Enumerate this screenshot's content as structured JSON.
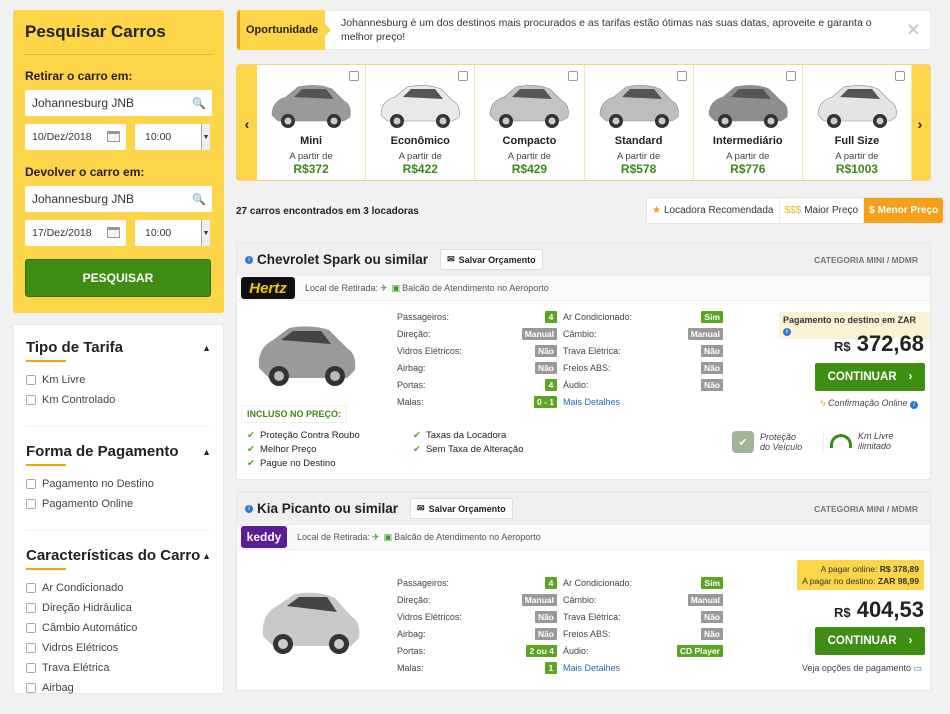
{
  "search": {
    "title": "Pesquisar Carros",
    "pickup_label": "Retirar o carro em:",
    "pickup_location": "Johannesburg JNB",
    "pickup_date": "10/Dez/2018",
    "pickup_time": "10:00",
    "return_label": "Devolver o carro em:",
    "return_location": "Johannesburg JNB",
    "return_date": "17/Dez/2018",
    "return_time": "10:00",
    "button": "PESQUISAR"
  },
  "filters": [
    {
      "title": "Tipo de Tarifa",
      "options": [
        "Km Livre",
        "Km Controlado"
      ]
    },
    {
      "title": "Forma de Pagamento",
      "options": [
        "Pagamento no Destino",
        "Pagamento Online"
      ]
    },
    {
      "title": "Características do Carro",
      "options": [
        "Ar Condicionado",
        "Direção Hidráulica",
        "Câmbio Automático",
        "Vidros Elétricos",
        "Trava Elétrica",
        "Airbag"
      ]
    }
  ],
  "banner": {
    "tag": "Oportunidade",
    "text": "Johannesburg é um dos destinos mais procurados e as tarifas estão ótimas nas suas datas, aproveite e garanta o melhor preço!",
    "close": "✕"
  },
  "categories": [
    {
      "name": "Mini",
      "from": "A partir de",
      "price": "R$372",
      "color": "#9a9a9a"
    },
    {
      "name": "Econômico",
      "from": "A partir de",
      "price": "R$422",
      "color": "#e9e9e9"
    },
    {
      "name": "Compacto",
      "from": "A partir de",
      "price": "R$429",
      "color": "#c4c4c4"
    },
    {
      "name": "Standard",
      "from": "A partir de",
      "price": "R$578",
      "color": "#bdbdbd"
    },
    {
      "name": "Intermediário",
      "from": "A partir de",
      "price": "R$776",
      "color": "#8e8e8e"
    },
    {
      "name": "Full Size",
      "from": "A partir de",
      "price": "R$1003",
      "color": "#e4e4e4"
    }
  ],
  "results": {
    "count": "27 carros encontrados em 3 locadoras",
    "sort": [
      "Locadora Recomendada",
      "Maior Preço",
      "Menor Preço"
    ],
    "sort_prefix": [
      "★",
      "$$$",
      "$"
    ]
  },
  "cars": [
    {
      "title": "Chevrolet Spark ou similar",
      "save": "Salvar Orçamento",
      "category": "CATEGORIA MINI / MDMR",
      "provider": "Hertz",
      "pickup": "Local de Retirada:",
      "pickup_place": "Balcão de Atendimento no Aeroporto",
      "specs_left": [
        [
          "Passageiros:",
          "4",
          "g"
        ],
        [
          "Direção:",
          "Manual",
          "gr"
        ],
        [
          "Vidros Elétricos:",
          "Não",
          "gr"
        ],
        [
          "Airbag:",
          "Não",
          "gr"
        ],
        [
          "Portas:",
          "4",
          "g"
        ],
        [
          "Malas:",
          "0 - 1",
          "g"
        ]
      ],
      "specs_right": [
        [
          "Ar Condicionado:",
          "Sim",
          "g"
        ],
        [
          "Câmbio:",
          "Manual",
          "gr"
        ],
        [
          "Trava Elétrica:",
          "Não",
          "gr"
        ],
        [
          "Freios ABS:",
          "Não",
          "gr"
        ],
        [
          "Áudio:",
          "Não",
          "gr"
        ]
      ],
      "more": "Mais Detalhes",
      "payment_note": "Pagamento no destino em ZAR",
      "currency": "R$",
      "price": "372,68",
      "continue": "CONTINUAR",
      "confirm": "Confirmação Online",
      "included_label": "INCLUSO NO PREÇO:",
      "included_col1": [
        "Proteção Contra Roubo",
        "Melhor Preço",
        "Pague no Destino"
      ],
      "included_col2": [
        "Taxas da Locadora",
        "Sem Taxa de Alteração"
      ],
      "feature1": [
        "Proteção",
        "do Veículo"
      ],
      "feature2": [
        "Km Livre",
        "ilimitado"
      ]
    },
    {
      "title": "Kia Picanto ou similar",
      "save": "Salvar Orçamento",
      "category": "CATEGORIA MINI / MDMR",
      "provider": "keddy",
      "pickup": "Local de Retirada:",
      "pickup_place": "Balcão de Atendimento no Aeroporto",
      "specs_left": [
        [
          "Passageiros:",
          "4",
          "g"
        ],
        [
          "Direção:",
          "Manual",
          "gr"
        ],
        [
          "Vidros Elétricos:",
          "Não",
          "gr"
        ],
        [
          "Airbag:",
          "Não",
          "gr"
        ],
        [
          "Portas:",
          "2 ou 4",
          "g"
        ],
        [
          "Malas:",
          "1",
          "g"
        ]
      ],
      "specs_right": [
        [
          "Ar Condicionado:",
          "Sim",
          "g"
        ],
        [
          "Câmbio:",
          "Manual",
          "gr"
        ],
        [
          "Trava Elétrica:",
          "Não",
          "gr"
        ],
        [
          "Freios ABS:",
          "Não",
          "gr"
        ],
        [
          "Áudio:",
          "CD Player",
          "g"
        ]
      ],
      "more": "Mais Detalhes",
      "pay_online_label": "A pagar online:",
      "pay_online": "R$ 378,89",
      "pay_dest_label": "A pagar no destino:",
      "pay_dest": "ZAR 98,99",
      "currency": "R$",
      "price": "404,53",
      "continue": "CONTINUAR",
      "payment_options": "Veja opções de pagamento"
    }
  ]
}
